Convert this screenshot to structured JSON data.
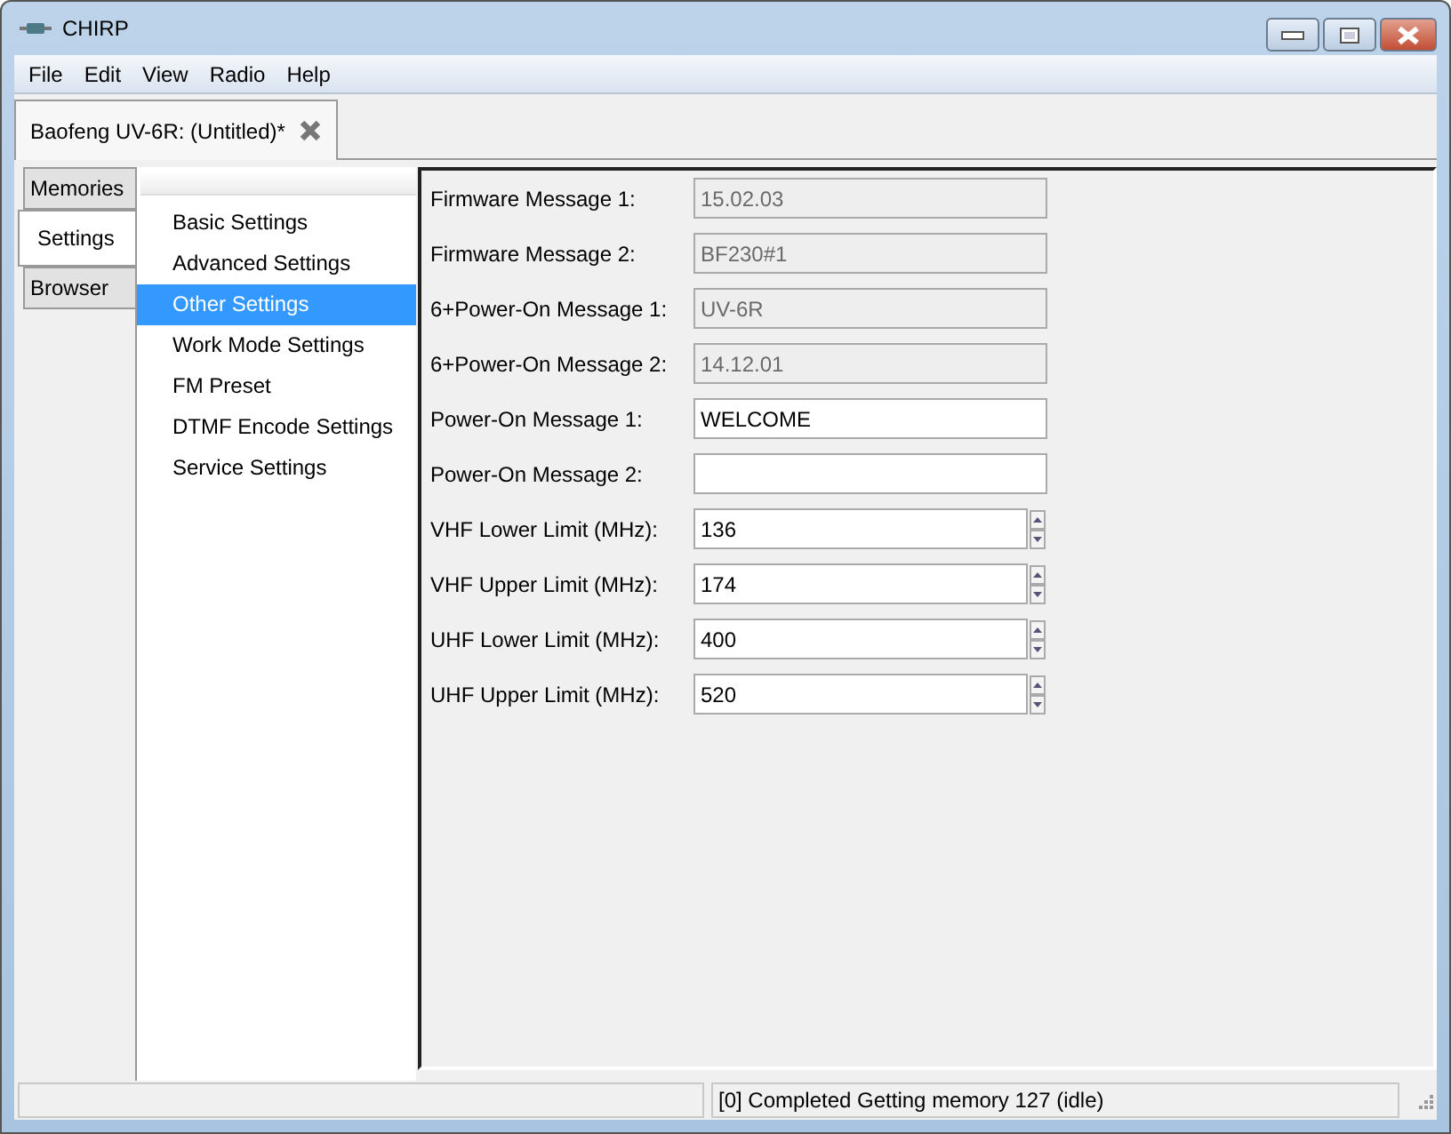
{
  "window": {
    "title": "CHIRP"
  },
  "menu": [
    "File",
    "Edit",
    "View",
    "Radio",
    "Help"
  ],
  "document_tabs": [
    {
      "label": "Baofeng UV-6R: (Untitled)*",
      "selected": true
    }
  ],
  "side_tabs": [
    {
      "label": "Memories",
      "selected": false
    },
    {
      "label": "Settings",
      "selected": true
    },
    {
      "label": "Browser",
      "selected": false
    }
  ],
  "settings_tree": [
    {
      "label": "Basic Settings",
      "selected": false
    },
    {
      "label": "Advanced Settings",
      "selected": false
    },
    {
      "label": "Other Settings",
      "selected": true
    },
    {
      "label": "Work Mode Settings",
      "selected": false
    },
    {
      "label": "FM Preset",
      "selected": false
    },
    {
      "label": "DTMF Encode Settings",
      "selected": false
    },
    {
      "label": "Service Settings",
      "selected": false
    }
  ],
  "fields": [
    {
      "label": "Firmware Message 1:",
      "kind": "text",
      "value": "15.02.03",
      "disabled": true
    },
    {
      "label": "Firmware Message 2:",
      "kind": "text",
      "value": "BF230#1",
      "disabled": true
    },
    {
      "label": "6+Power-On Message 1:",
      "kind": "text",
      "value": "UV-6R",
      "disabled": true
    },
    {
      "label": "6+Power-On Message 2:",
      "kind": "text",
      "value": "14.12.01",
      "disabled": true
    },
    {
      "label": "Power-On Message 1:",
      "kind": "text",
      "value": "WELCOME",
      "disabled": false
    },
    {
      "label": "Power-On Message 2:",
      "kind": "text",
      "disabled": false
    },
    {
      "label": "VHF Lower Limit (MHz):",
      "kind": "spin",
      "value": "136",
      "disabled": false
    },
    {
      "label": "VHF Upper Limit (MHz):",
      "kind": "spin",
      "value": "174",
      "disabled": false
    },
    {
      "label": "UHF Lower Limit (MHz):",
      "kind": "spin",
      "value": "400",
      "disabled": false
    },
    {
      "label": "UHF Upper Limit (MHz):",
      "kind": "spin",
      "value": "520",
      "disabled": false
    }
  ],
  "status_bar": {
    "message": "[0] Completed Getting memory 127 (idle)"
  }
}
